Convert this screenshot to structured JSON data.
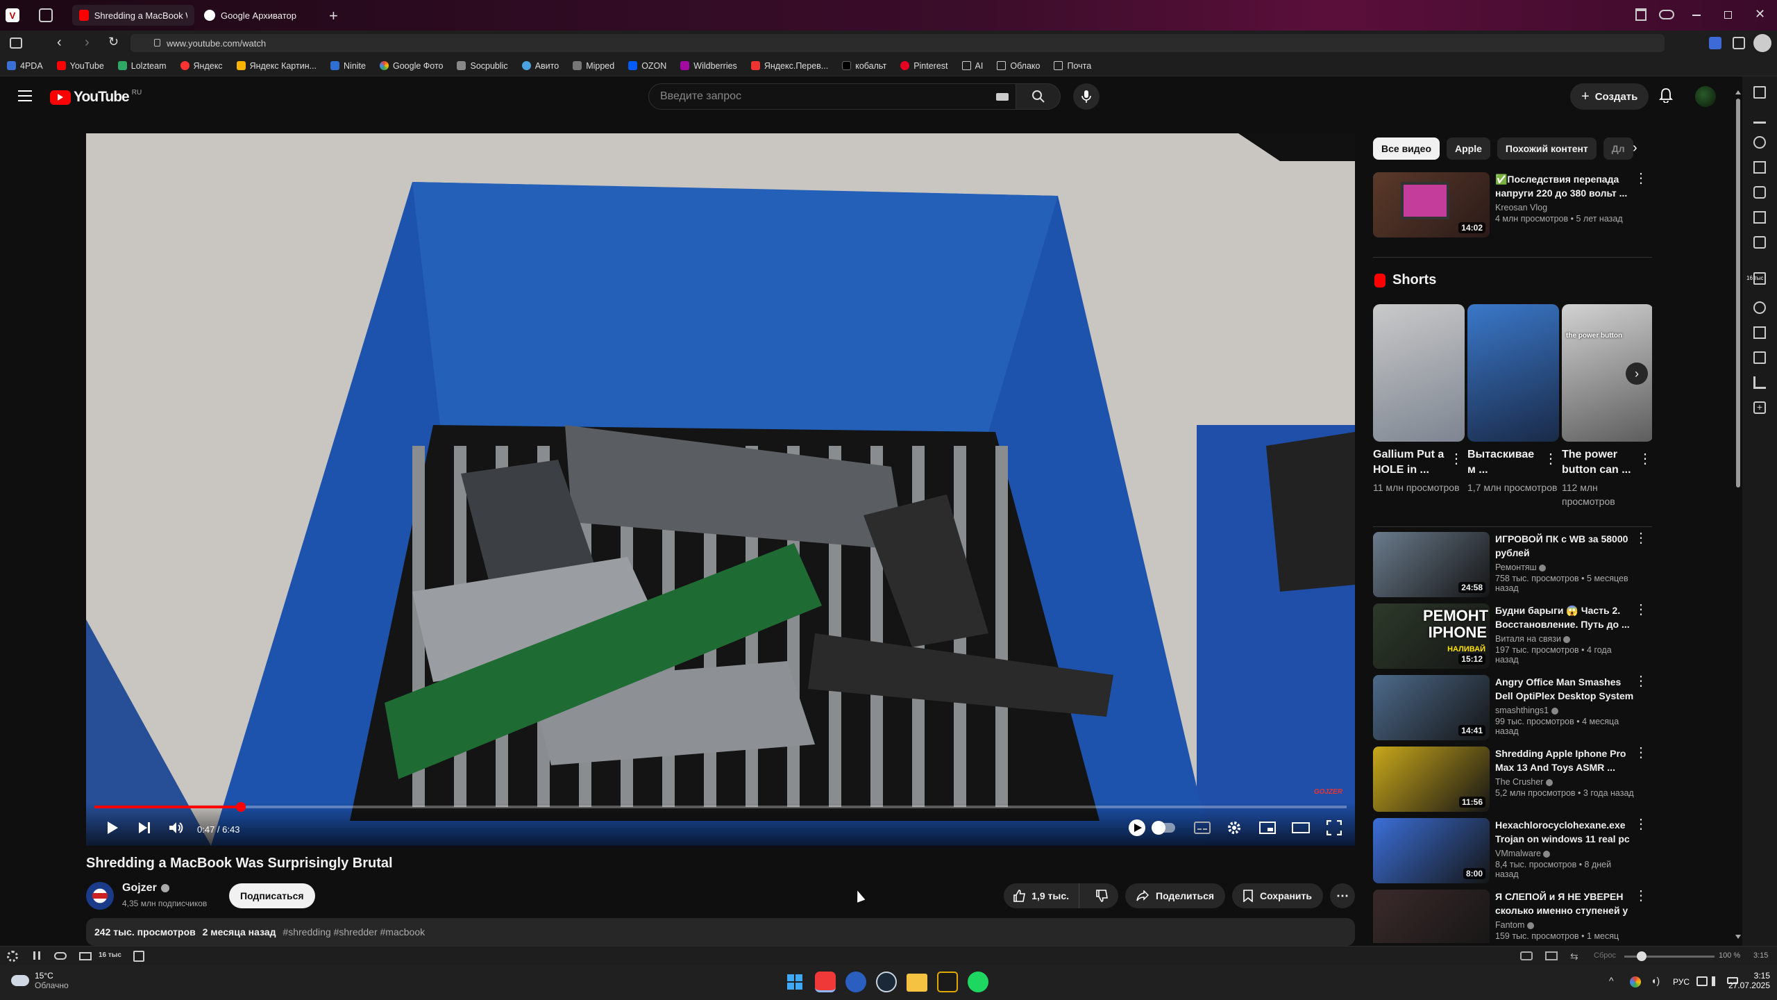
{
  "browser": {
    "tabs": [
      {
        "title": "Shredding a MacBook Was",
        "active": true
      },
      {
        "title": "Google Архиватор",
        "active": false
      }
    ],
    "url": "www.youtube.com/watch",
    "bookmarks": [
      "4PDA",
      "YouTube",
      "Lolzteam",
      "Яндекс",
      "Яндекс Картин...",
      "Ninite",
      "Google Фото",
      "Socpublic",
      "Авито",
      "Mipped",
      "OZON",
      "Wildberries",
      "Яндекс.Перев...",
      "кобальт",
      "Pinterest",
      "AI",
      "Облако",
      "Почта"
    ]
  },
  "youtube": {
    "logo_text": "YouTube",
    "region": "RU",
    "search_placeholder": "Введите запрос",
    "create_label": "Создать"
  },
  "player": {
    "time": "0:47 / 6:43",
    "progress": 0.117,
    "watermark": "GOJZER"
  },
  "video": {
    "title": "Shredding a MacBook Was Surprisingly Brutal",
    "channel": "Gojzer",
    "subscribers": "4,35 млн подписчиков",
    "subscribe_label": "Подписаться",
    "likes": "1,9 тыс.",
    "share_label": "Поделиться",
    "save_label": "Сохранить",
    "views": "242 тыс. просмотров",
    "date": "2 месяца назад",
    "tags": "#shredding #shredder #macbook"
  },
  "chips": [
    "Все видео",
    "Apple",
    "Похожий контент",
    "Дл"
  ],
  "recommendations_top": {
    "title": "✅Последствия перепада напруги 220 до 380 вольт ...",
    "channel": "Kreosan Vlog",
    "stats": "4 млн просмотров • 5 лет назад",
    "duration": "14:02"
  },
  "shorts": {
    "heading": "Shorts",
    "items": [
      {
        "title": "Gallium Put a HOLE in ...",
        "views": "11 млн просмотров"
      },
      {
        "title": "Вытаскивае м ...",
        "views": "1,7 млн просмотров"
      },
      {
        "title": "The power button can ...",
        "views": "112 млн просмотров",
        "overlay": "the power button"
      }
    ]
  },
  "recommendations": [
    {
      "title": "ИГРОВОЙ ПК с WB за 58000 рублей",
      "channel": "Ремонтяш",
      "stats": "758 тыс. просмотров • 5 месяцев назад",
      "duration": "24:58",
      "color": "#6a7b8c"
    },
    {
      "title": "Будни барыги 😱 Часть 2. Восстановление. Путь до ...",
      "channel": "Виталя на связи",
      "stats": "197 тыс. просмотров • 4 года назад",
      "duration": "15:12",
      "thumb_text": "РЕМОНТ IPHONE",
      "thumb_sub": "НАЛИВАЙ",
      "color": "#2d3a2a"
    },
    {
      "title": "Angry Office Man Smashes Dell OptiPlex Desktop System",
      "channel": "smashthings1",
      "stats": "99 тыс. просмотров • 4 месяца назад",
      "duration": "14:41",
      "color": "#4d6a8a"
    },
    {
      "title": "Shredding Apple Iphone Pro Max 13 And Toys ASMR ...",
      "channel": "The Crusher",
      "stats": "5,2 млн просмотров • 3 года назад",
      "duration": "11:56",
      "color": "#c8a81a"
    },
    {
      "title": "Hexachlorocyclohexane.exe Trojan on windows 11 real pc",
      "channel": "VMmalware",
      "stats": "8,4 тыс. просмотров • 8 дней назад",
      "duration": "8:00",
      "color": "#3b6fd8"
    },
    {
      "title": "Я СЛЕПОЙ и Я НЕ УВЕРЕН сколько именно ступеней у ...",
      "channel": "Fantom",
      "stats": "159 тыс. просмотров • 1 месяц назад",
      "duration": "",
      "color": "#3a2a2a"
    }
  ],
  "statusbar": {
    "reset_label": "Сброс",
    "zoom": "100 %",
    "time": "3:15",
    "mail_badge": "16 тыс"
  },
  "taskbar": {
    "temperature": "15°C",
    "weather": "Облачно",
    "lang": "РУС",
    "time": "3:15",
    "date": "27.07.2025"
  }
}
